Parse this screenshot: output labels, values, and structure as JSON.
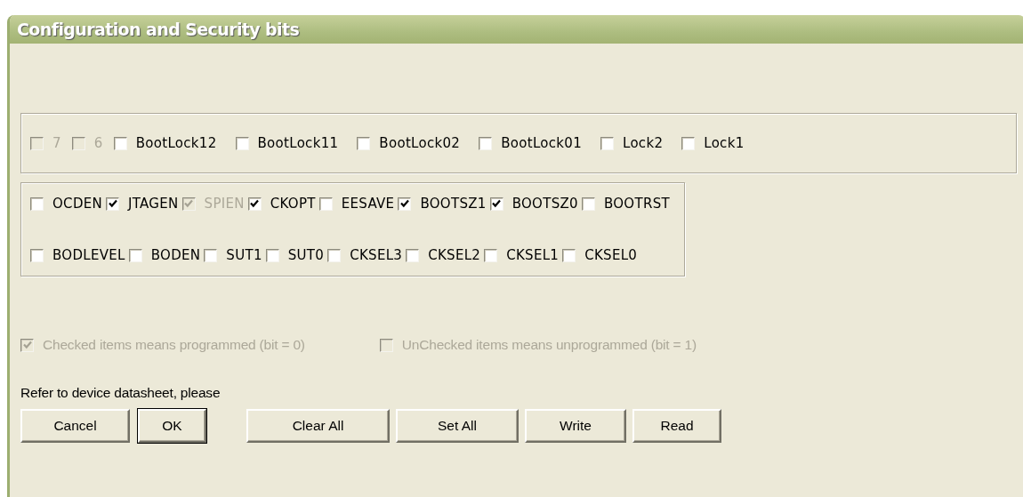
{
  "window": {
    "title": "Configuration and Security bits"
  },
  "groups": [
    {
      "rows": [
        [
          {
            "label": "7",
            "checked": false,
            "disabled": true
          },
          {
            "label": "6",
            "checked": false,
            "disabled": true
          },
          {
            "label": "BootLock12",
            "checked": false,
            "disabled": false
          },
          {
            "label": "BootLock11",
            "checked": false,
            "disabled": false
          },
          {
            "label": "BootLock02",
            "checked": false,
            "disabled": false
          },
          {
            "label": "BootLock01",
            "checked": false,
            "disabled": false
          },
          {
            "label": "Lock2",
            "checked": false,
            "disabled": false
          },
          {
            "label": "Lock1",
            "checked": false,
            "disabled": false
          }
        ]
      ]
    },
    {
      "rows": [
        [
          {
            "label": "OCDEN",
            "checked": false,
            "disabled": false
          },
          {
            "label": "JTAGEN",
            "checked": true,
            "disabled": false
          },
          {
            "label": "SPIEN",
            "checked": true,
            "disabled": true
          },
          {
            "label": "CKOPT",
            "checked": true,
            "disabled": false
          },
          {
            "label": "EESAVE",
            "checked": false,
            "disabled": false
          },
          {
            "label": "BOOTSZ1",
            "checked": true,
            "disabled": false
          },
          {
            "label": "BOOTSZ0",
            "checked": true,
            "disabled": false
          },
          {
            "label": "BOOTRST",
            "checked": false,
            "disabled": false
          }
        ],
        [
          {
            "label": "BODLEVEL",
            "checked": false,
            "disabled": false
          },
          {
            "label": "BODEN",
            "checked": false,
            "disabled": false
          },
          {
            "label": "SUT1",
            "checked": false,
            "disabled": false
          },
          {
            "label": "SUT0",
            "checked": false,
            "disabled": false
          },
          {
            "label": "CKSEL3",
            "checked": false,
            "disabled": false
          },
          {
            "label": "CKSEL2",
            "checked": false,
            "disabled": false
          },
          {
            "label": "CKSEL1",
            "checked": false,
            "disabled": false
          },
          {
            "label": "CKSEL0",
            "checked": false,
            "disabled": false
          }
        ]
      ]
    }
  ],
  "legend": [
    {
      "label": "Checked items means programmed (bit = 0)",
      "checked": true,
      "disabled": true
    },
    {
      "label": "UnChecked items means unprogrammed (bit = 1)",
      "checked": false,
      "disabled": true
    }
  ],
  "note": "Refer to device datasheet, please",
  "buttons": [
    {
      "label": "Cancel",
      "default": false
    },
    {
      "label": "OK",
      "default": true
    },
    {
      "label": "Clear All",
      "default": false
    },
    {
      "label": "Set All",
      "default": false
    },
    {
      "label": "Write",
      "default": false
    },
    {
      "label": "Read",
      "default": false
    }
  ]
}
